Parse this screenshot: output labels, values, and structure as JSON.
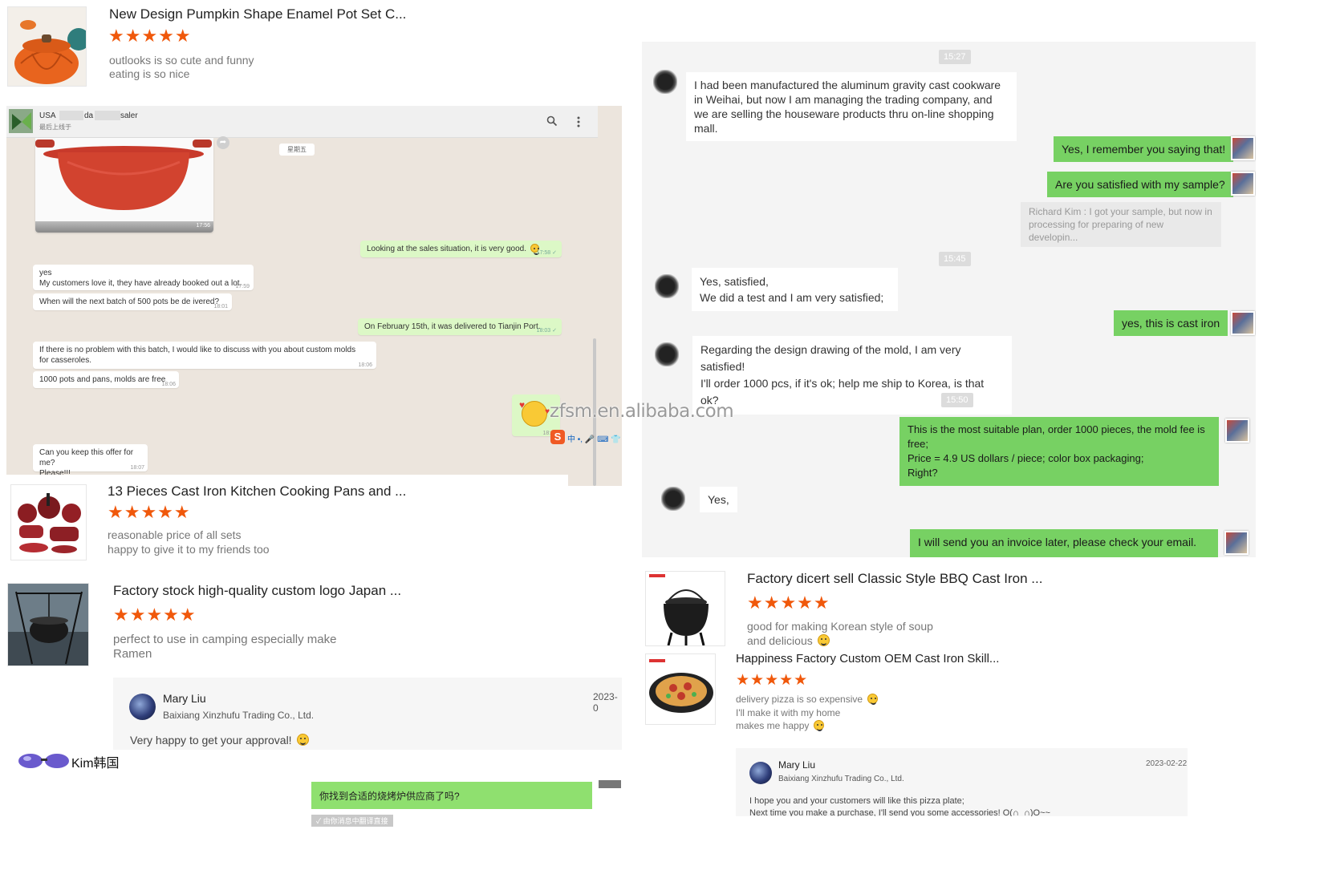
{
  "reviews": [
    {
      "title": "New Design Pumpkin Shape Enamel Pot Set C...",
      "stars": "★★★★★",
      "rating": 5,
      "lines": [
        "outlooks is so cute and funny",
        "eating is so nice"
      ]
    },
    {
      "title": "13 Pieces Cast Iron Kitchen Cooking Pans and ...",
      "stars": "★★★★★",
      "rating": 5,
      "lines": [
        "reasonable price of all sets",
        "happy to give it to my friends too"
      ]
    },
    {
      "title": "Factory stock high-quality custom logo Japan ...",
      "stars": "★★★★★",
      "rating": 5,
      "lines": [
        "perfect to use in camping especially make",
        "Ramen"
      ]
    },
    {
      "title": "Factory dicert sell Classic Style BBQ Cast Iron ...",
      "stars": "★★★★★",
      "rating": 5,
      "lines": [
        "good for making Korean style of soup",
        "and delicious"
      ]
    },
    {
      "title": "Happiness Factory Custom OEM Cast Iron Skill...",
      "stars": "★★★★★",
      "rating": 5,
      "lines": [
        "delivery pizza is so expensive",
        "I'll make it with my home",
        "makes me happy"
      ]
    }
  ],
  "whatsapp": {
    "contact_country": "USA",
    "contact_name_a": "da",
    "contact_name_b": "saler",
    "contact_status": "最后上线于",
    "day_chip": "星期五",
    "image_time": "17:56",
    "messages": [
      {
        "text": "Looking at the sales situation, it is very good.",
        "time": "17:58 ✓"
      },
      {
        "text": "yes",
        "time": ""
      },
      {
        "text": "My customers love it, they have already booked out a lot.",
        "time": "17:59"
      },
      {
        "text": "When will the next batch of 500 pots be de ivered?",
        "time": "18:01"
      },
      {
        "text": "On February 15th, it was delivered to Tianjin Port.",
        "time": "18:03 ✓"
      },
      {
        "text": "If there is no problem with this batch, I would like to discuss with you about custom molds for casseroles.",
        "time": "18:06"
      },
      {
        "text": "1000 pots and pans, molds are free",
        "time": "18:06"
      },
      {
        "text": "",
        "time": "18:06"
      },
      {
        "text": "Can you keep this offer for me?",
        "time": ""
      },
      {
        "text": "Please!!!",
        "time": "18:07"
      }
    ],
    "ime_icons": "中 •, 🎤 ⌨ 👕"
  },
  "right_chat": {
    "stamps": [
      "15:27",
      "15:45",
      "15:50"
    ],
    "messages": [
      {
        "from": "in",
        "text": "I had been manufactured the aluminum gravity cast cookware in Weihai, but now I am managing the trading company, and we are selling the houseware products thru on-line shopping mall."
      },
      {
        "from": "out",
        "text": "Yes, I remember you saying that!"
      },
      {
        "from": "out",
        "text": "Are you satisfied with my sample?"
      },
      {
        "from": "quote",
        "text": "Richard Kim : I got your sample, but now in processing for preparing of new developin..."
      },
      {
        "from": "in",
        "text": "Yes, satisfied,\nWe did a test and I am very satisfied;"
      },
      {
        "from": "out",
        "text": "yes,  this is cast iron"
      },
      {
        "from": "in",
        "text": "Regarding the design drawing of the mold, I am very satisfied!\nI'll order 1000 pcs, if it's ok; help me ship to Korea, is that ok?"
      },
      {
        "from": "out",
        "text": "This is the most suitable plan, order 1000 pieces, the mold fee is free;\nPrice = 4.9 US dollars / piece; color box packaging;\nRight?"
      },
      {
        "from": "in",
        "text": "Yes,"
      },
      {
        "from": "out",
        "text": "I will send you an invoice later, please check your email."
      }
    ]
  },
  "replies": [
    {
      "name": "Mary Liu",
      "company": "Baixiang Xinzhufu Trading Co., Ltd.",
      "date": "2023-0",
      "text": "Very happy to get your approval!"
    },
    {
      "name": "Mary Liu",
      "company": "Baixiang Xinzhufu Trading Co., Ltd.",
      "date": "2023-02-22",
      "text": "I hope you and your customers will like this pizza plate;",
      "text2": "Next time you make a purchase, I'll send you some accessories! O(∩_∩)O~~"
    }
  ],
  "kakao": {
    "name": "Kim韩国",
    "message": "你找到合适的烧烤炉供应商了吗?",
    "footer": "✓ 由你消息中翻译直接"
  },
  "watermark": "zfsm.en.alibaba.com",
  "colors": {
    "star": "#f0580b",
    "whatsapp_green": "#00a884",
    "chat_out": "#77d163",
    "wa_out": "#dcf8c6"
  }
}
